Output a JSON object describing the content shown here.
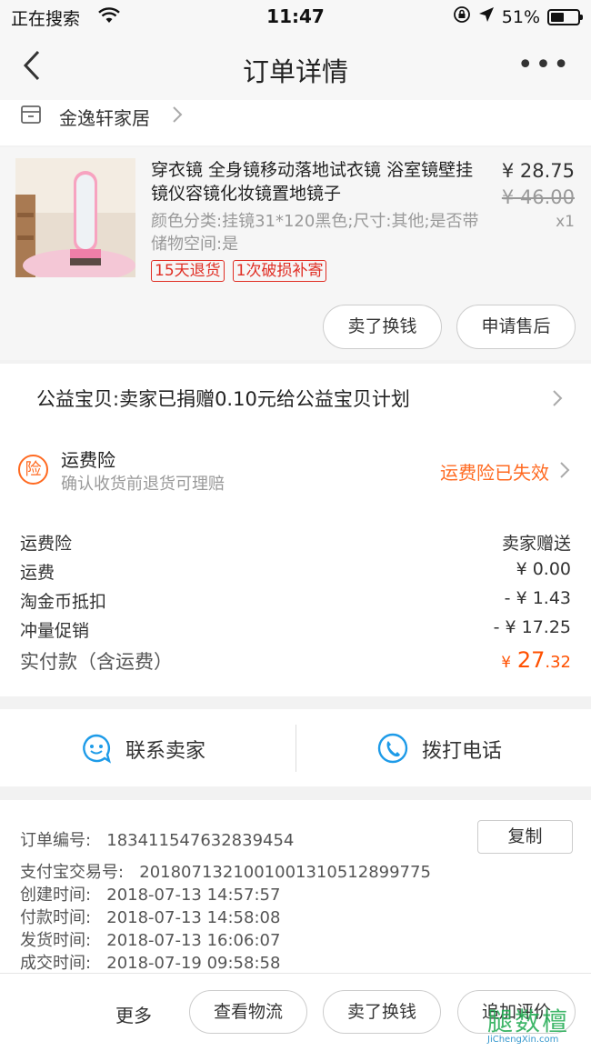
{
  "status_bar": {
    "carrier": "正在搜索",
    "time": "11:47",
    "battery": "51%",
    "battery_level": 0.51
  },
  "nav": {
    "title": "订单详情",
    "more": "•••"
  },
  "store": {
    "name": "金逸轩家居"
  },
  "product": {
    "title": "穿衣镜 全身镜移动落地试衣镜 浴室镜壁挂镜仪容镜化妆镜置地镜子",
    "sku": "颜色分类:挂镜31*120黑色;尺寸:其他;是否带储物空间:是",
    "tags": [
      "15天退货",
      "1次破损补寄"
    ],
    "price": "¥ 28.75",
    "original_price": "¥ 46.00",
    "quantity": "x1",
    "buttons": {
      "sell": "卖了换钱",
      "after_sale": "申请售后"
    }
  },
  "charity": {
    "text": "公益宝贝:卖家已捐赠0.10元给公益宝贝计划"
  },
  "insurance": {
    "icon_text": "险",
    "title": "运费险",
    "subtitle": "确认收货前退货可理赔",
    "status": "运费险已失效"
  },
  "fees": [
    {
      "label": "运费险",
      "value": "卖家赠送"
    },
    {
      "label": "运费",
      "value": "¥ 0.00"
    },
    {
      "label": "淘金币抵扣",
      "value": "- ¥ 1.43"
    },
    {
      "label": "冲量促销",
      "value": "- ¥ 17.25"
    }
  ],
  "total": {
    "label": "实付款（含运费）",
    "currency": "¥",
    "int": "27",
    "dec": ".32"
  },
  "contact": {
    "seller": "联系卖家",
    "phone": "拨打电话"
  },
  "order_info": {
    "copy_label": "复制",
    "rows": [
      {
        "label": "订单编号:",
        "value": "183411547632839454"
      },
      {
        "label": "支付宝交易号:",
        "value": "2018071321001001310512899775"
      },
      {
        "label": "创建时间:",
        "value": "2018-07-13 14:57:57"
      },
      {
        "label": "付款时间:",
        "value": "2018-07-13 14:58:08"
      },
      {
        "label": "发货时间:",
        "value": "2018-07-13 16:06:07"
      },
      {
        "label": "成交时间:",
        "value": "2018-07-19 09:58:58"
      }
    ]
  },
  "bottom_bar": {
    "more": "更多",
    "logistics": "查看物流",
    "sell": "卖了换钱",
    "review": "追加评价"
  },
  "watermark": {
    "big": "腿数檀",
    "small": "JiChengXin.com"
  },
  "colors": {
    "accent": "#ff5000",
    "tag_red": "#e02e24",
    "insurance_orange": "#ff6a21",
    "contact_blue": "#1e9be8"
  }
}
